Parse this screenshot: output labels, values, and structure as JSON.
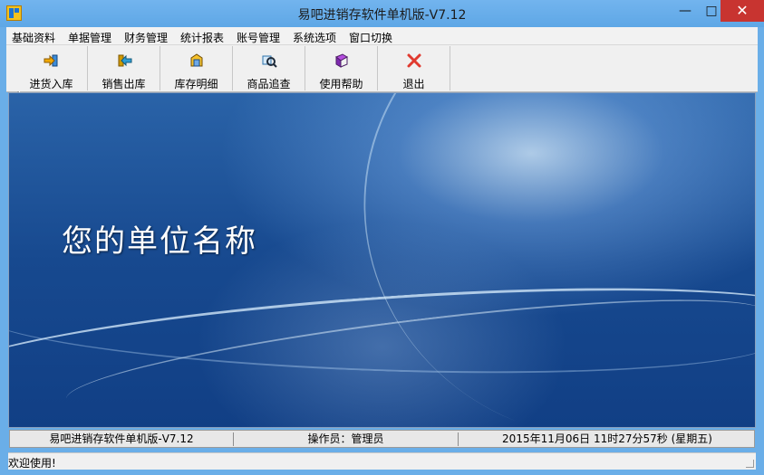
{
  "window": {
    "title": "易吧进销存软件单机版-V7.12",
    "controls": {
      "minimize": "—",
      "maximize": "□",
      "close": "✕"
    }
  },
  "menu": [
    "基础资料",
    "单据管理",
    "财务管理",
    "统计报表",
    "账号管理",
    "系统选项",
    "窗口切换"
  ],
  "toolbar": [
    {
      "label": "进货入库",
      "icon": "purchase-in-icon",
      "color": "#f0a400"
    },
    {
      "label": "销售出库",
      "icon": "sales-out-icon",
      "color": "#2d9ccf"
    },
    {
      "label": "库存明细",
      "icon": "inventory-icon",
      "color": "#e6a700"
    },
    {
      "label": "商品追查",
      "icon": "search-product-icon",
      "color": "#4aa0d8"
    },
    {
      "label": "使用帮助",
      "icon": "help-book-icon",
      "color": "#8a3fc8"
    },
    {
      "label": "退出",
      "icon": "exit-icon",
      "color": "#e03a2f"
    }
  ],
  "main": {
    "company_name": "您的单位名称"
  },
  "status_bar": {
    "product": "易吧进销存软件单机版-V7.12",
    "operator": "操作员：管理员",
    "datetime": "2015年11月06日 11时27分57秒 (星期五)"
  },
  "bottom_status": {
    "message": "欢迎使用!"
  },
  "colors": {
    "title_bar": "#5ea7e6",
    "close_button": "#c83430",
    "background_blue": "#17498f"
  }
}
